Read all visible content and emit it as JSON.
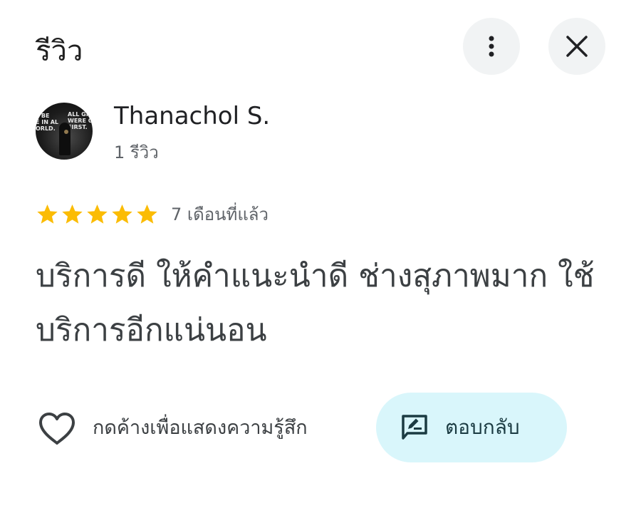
{
  "header": {
    "title": "รีวิว",
    "more_icon": "more-vert-icon",
    "close_icon": "close-icon"
  },
  "reviewer": {
    "name": "Thanachol S.",
    "review_count": "1 รีวิว",
    "avatar_text_left": "L BE\nE IN AL\nORLD.",
    "avatar_text_right": "ALL GI\nWERE C\nFIRST."
  },
  "rating": {
    "stars": 5,
    "max_stars": 5,
    "star_color": "#fbbc04",
    "time_ago": "7 เดือนที่แล้ว"
  },
  "review": {
    "text": "บริการดี ให้คำแนะนำดี ช่างสุภาพมาก ใช้บริการอีกแน่นอน"
  },
  "actions": {
    "like_icon": "heart-outline-icon",
    "like_label": "กดค้างเพื่อแสดงความรู้สึก",
    "reply_icon": "rate-review-icon",
    "reply_label": "ตอบกลับ",
    "reply_bg": "#d9f6fb"
  }
}
